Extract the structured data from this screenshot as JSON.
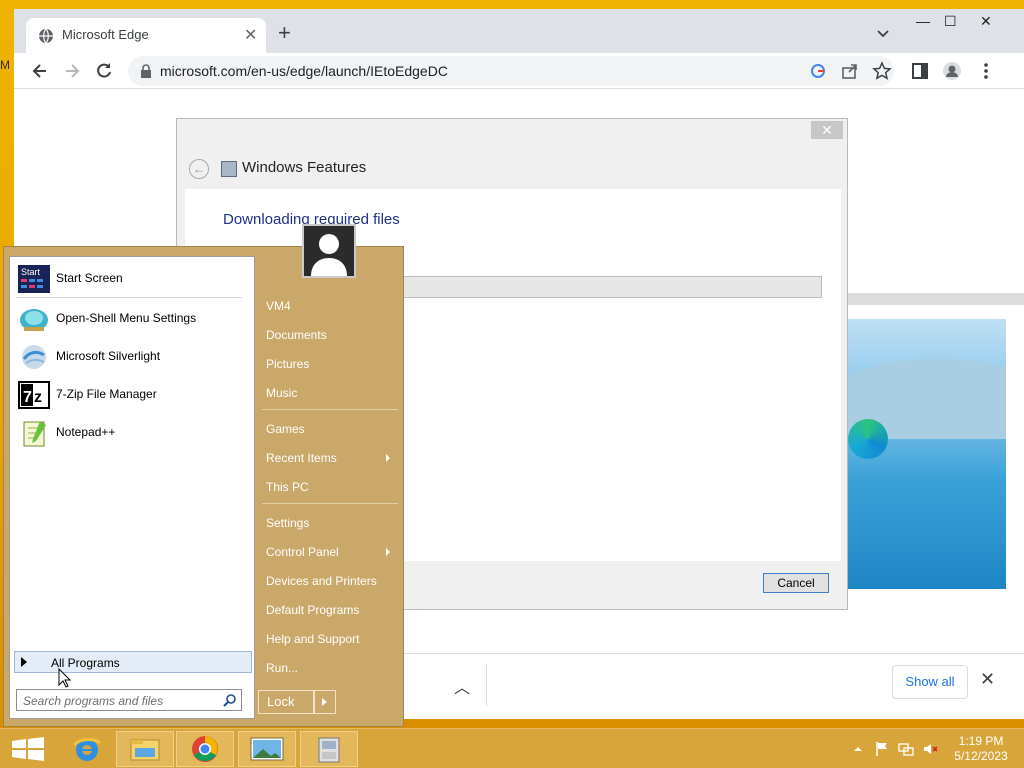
{
  "desktop": {
    "edge_mark": "M"
  },
  "browser": {
    "tab_title": "Microsoft Edge",
    "new_tab_label": "+",
    "url": "microsoft.com/en-us/edge/launch/IEtoEdgeDC",
    "download_bar": {
      "show_all_label": "Show all"
    }
  },
  "dialog": {
    "title": "Windows Features",
    "heading": "Downloading required files",
    "progress": 0,
    "cancel_label": "Cancel"
  },
  "start_menu": {
    "pinned": [
      {
        "label": "Start Screen",
        "icon": "start-screen-icon"
      },
      {
        "label": "Open-Shell Menu Settings",
        "icon": "open-shell-icon"
      },
      {
        "label": "Microsoft Silverlight",
        "icon": "silverlight-icon"
      },
      {
        "label": "7-Zip File Manager",
        "icon": "7zip-icon"
      },
      {
        "label": "Notepad++",
        "icon": "notepadpp-icon"
      }
    ],
    "all_programs": "All Programs",
    "search_placeholder": "Search programs and files",
    "right_items": [
      {
        "label": "VM4"
      },
      {
        "label": "Documents"
      },
      {
        "label": "Pictures"
      },
      {
        "label": "Music"
      },
      {
        "label": "Games"
      },
      {
        "label": "Recent Items"
      },
      {
        "label": "This PC"
      },
      {
        "label": "Settings"
      },
      {
        "label": "Control Panel"
      },
      {
        "label": "Devices and Printers"
      },
      {
        "label": "Default Programs"
      },
      {
        "label": "Help and Support"
      },
      {
        "label": "Run..."
      }
    ],
    "lock_label": "Lock"
  },
  "taskbar": {
    "apps": [
      "start-button",
      "internet-explorer",
      "file-explorer",
      "chrome",
      "image-viewer",
      "app"
    ],
    "time": "1:19 PM",
    "date": "5/12/2023"
  },
  "colors": {
    "taskbar": "#d8a53a",
    "start_menu": "#c9a86a",
    "desktop": "#f0b400",
    "link": "#1a73e8"
  }
}
